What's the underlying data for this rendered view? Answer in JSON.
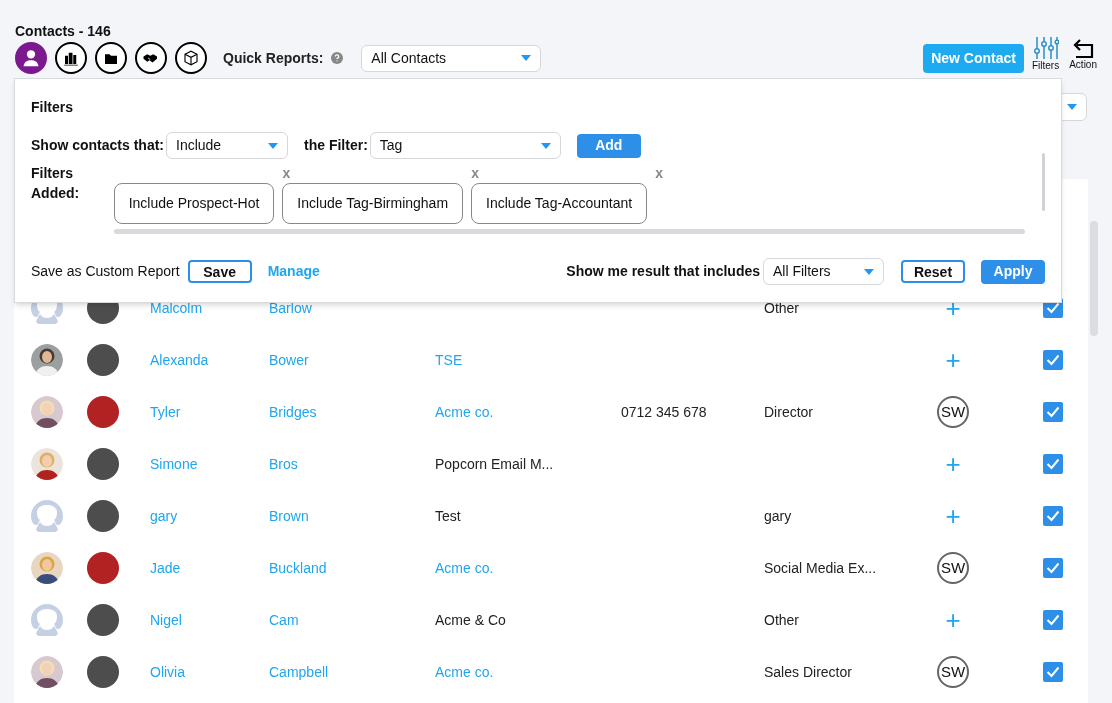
{
  "title": "Contacts - 146",
  "module_tabs": [
    {
      "selected": true
    },
    {
      "selected": false
    },
    {
      "selected": false
    },
    {
      "selected": false
    },
    {
      "selected": false
    }
  ],
  "quick_reports": {
    "label": "Quick Reports:",
    "value": "All Contacts"
  },
  "toolbar": {
    "new_button": "New Contact",
    "filters_label": "Filters",
    "action_label": "Action"
  },
  "filter_panel": {
    "title": "Filters",
    "show_label": "Show contacts that:",
    "show_value": "Include",
    "filter_label": "the Filter:",
    "filter_value": "Tag",
    "add_button": "Add",
    "added_label": "Filters Added:",
    "chips": [
      {
        "label": "Include Prospect-Hot",
        "remove": "x"
      },
      {
        "label": "Include Tag-Birmingham",
        "remove": "x"
      },
      {
        "label": "Include Tag-Accountant",
        "remove": "x"
      }
    ],
    "save_label": "Save as Custom Report",
    "save_button": "Save",
    "manage_link": "Manage",
    "result_label": "Show me result that includes",
    "result_value": "All Filters",
    "reset_button": "Reset",
    "apply_button": "Apply"
  },
  "rows": [
    {
      "avatar": {
        "kind": "placeholder"
      },
      "color": "#4d4d4d",
      "first": "Malcolm",
      "last": "Barlow",
      "job": "Other",
      "owner": {
        "kind": "add",
        "text": "+"
      },
      "checked": true
    },
    {
      "color": "#4d4d4d",
      "first": "Alexanda",
      "last": "Bower",
      "company": "TSE",
      "company_linked": true,
      "owner": {
        "kind": "add",
        "text": "+"
      },
      "checked": true
    },
    {
      "color": "#b22222",
      "first": "Tyler",
      "last": "Bridges",
      "company": "Acme co.",
      "company_linked": true,
      "phone": "0712 345 678",
      "job": "Director",
      "owner": {
        "kind": "initials",
        "text": "SW"
      },
      "checked": true
    },
    {
      "color": "#4d4d4d",
      "first": "Simone",
      "last": "Bros",
      "company": "Popcorn Email M...",
      "company_linked": false,
      "owner": {
        "kind": "add",
        "text": "+"
      },
      "checked": true
    },
    {
      "avatar": {
        "kind": "placeholder"
      },
      "color": "#4d4d4d",
      "first": "gary",
      "last": "Brown",
      "company": "Test",
      "company_linked": false,
      "job": "gary",
      "owner": {
        "kind": "add",
        "text": "+"
      },
      "checked": true
    },
    {
      "color": "#b22222",
      "first": "Jade",
      "last": "Buckland",
      "company": "Acme co.",
      "company_linked": true,
      "job": "Social Media Ex...",
      "owner": {
        "kind": "initials",
        "text": "SW"
      },
      "checked": true
    },
    {
      "avatar": {
        "kind": "placeholder"
      },
      "color": "#4d4d4d",
      "first": "Nigel",
      "last": "Cam",
      "company": "Acme & Co",
      "company_linked": false,
      "job": "Other",
      "owner": {
        "kind": "add",
        "text": "+"
      },
      "checked": true
    },
    {
      "color": "#4d4d4d",
      "first": "Olivia",
      "last": "Campbell",
      "company": "Acme co.",
      "company_linked": true,
      "job": "Sales Director",
      "owner": {
        "kind": "initials",
        "text": "SW"
      },
      "checked": true
    }
  ]
}
